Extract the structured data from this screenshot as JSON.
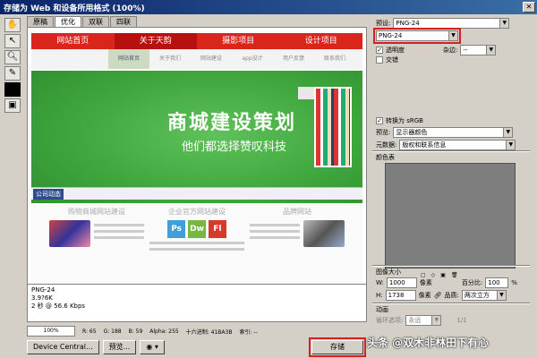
{
  "window": {
    "title": "存储为 Web 和设备所用格式 (100%)"
  },
  "preview_tabs": [
    "原稿",
    "优化",
    "双联",
    "四联"
  ],
  "website": {
    "nav": [
      "网站首页",
      "关于天韵",
      "摄影项目",
      "设计项目"
    ],
    "subnav": [
      "网站首页",
      "关于我们",
      "网站建设",
      "app设计",
      "用户反馈",
      "联系我们"
    ],
    "banner_title": "商城建设策划",
    "banner_subtitle": "他们都选择赞叹科技",
    "news_tag": "公司动态",
    "cards": [
      {
        "title": "购物商城网站建设"
      },
      {
        "title": "企业官方网站建设",
        "icons": [
          "Ps",
          "Dw",
          "Fl"
        ]
      },
      {
        "title": "品牌网站"
      }
    ]
  },
  "info": {
    "format": "PNG-24",
    "size": "3.9?6K",
    "time": "2 秒 @ 56.6 Kbps"
  },
  "status": {
    "zoom": "100%",
    "r": "R: 65",
    "g": "G: 188",
    "b": "B: 59",
    "alpha": "Alpha: 255",
    "hex": "十六进制: 41BA3B",
    "index": "索引: --"
  },
  "buttons": {
    "device_central": "Device Central...",
    "preview": "预览...",
    "save": "存储"
  },
  "settings": {
    "preset_label": "预设:",
    "preset_value": "PNG-24",
    "format_value": "PNG-24",
    "transparency_label": "透明度",
    "matte_label": "杂边:",
    "matte_value": "--",
    "interlaced_label": "交错",
    "convert_srgb_label": "转换为 sRGB",
    "preview_label": "预览:",
    "preview_value": "显示器颜色",
    "metadata_label": "元数据:",
    "metadata_value": "版权和联系信息",
    "color_table_label": "颜色表",
    "image_size_label": "图像大小",
    "width_label": "W:",
    "width_value": "1000",
    "height_label": "H:",
    "height_value": "1738",
    "unit": "像素",
    "percent_label": "百分比:",
    "percent_value": "100",
    "quality_label": "品质:",
    "quality_value": "两次立方",
    "animation_label": "动画",
    "loop_label": "循环选项:",
    "loop_value": "永远",
    "frame_value": "1/1"
  },
  "watermark": "头条 @双木非林田下有心"
}
